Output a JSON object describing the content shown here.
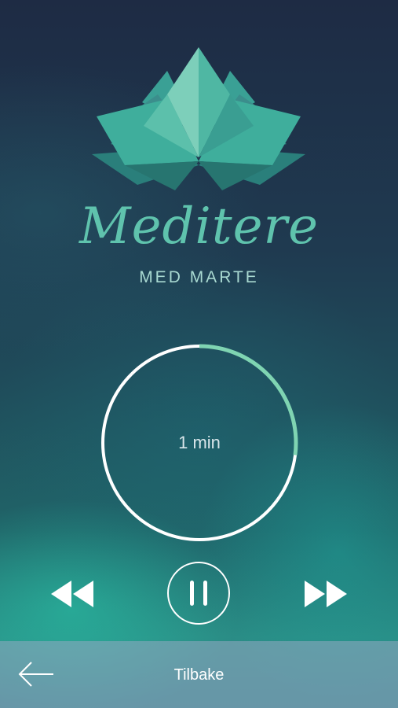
{
  "app": {
    "title": "Meditere",
    "subtitle": "MED MARTE"
  },
  "logo": {
    "icon": "lotus-icon"
  },
  "player": {
    "time_label": "1 min",
    "progress_fraction": 0.27,
    "state": "playing"
  },
  "controls": {
    "rewind_icon": "rewind-icon",
    "pause_icon": "pause-icon",
    "forward_icon": "fast-forward-icon"
  },
  "nav": {
    "back_icon": "back-arrow-icon",
    "back_label": "Tilbake"
  },
  "colors": {
    "accent": "#5fc3ad",
    "progress": "#7fd4b2",
    "ring": "#ffffff"
  }
}
